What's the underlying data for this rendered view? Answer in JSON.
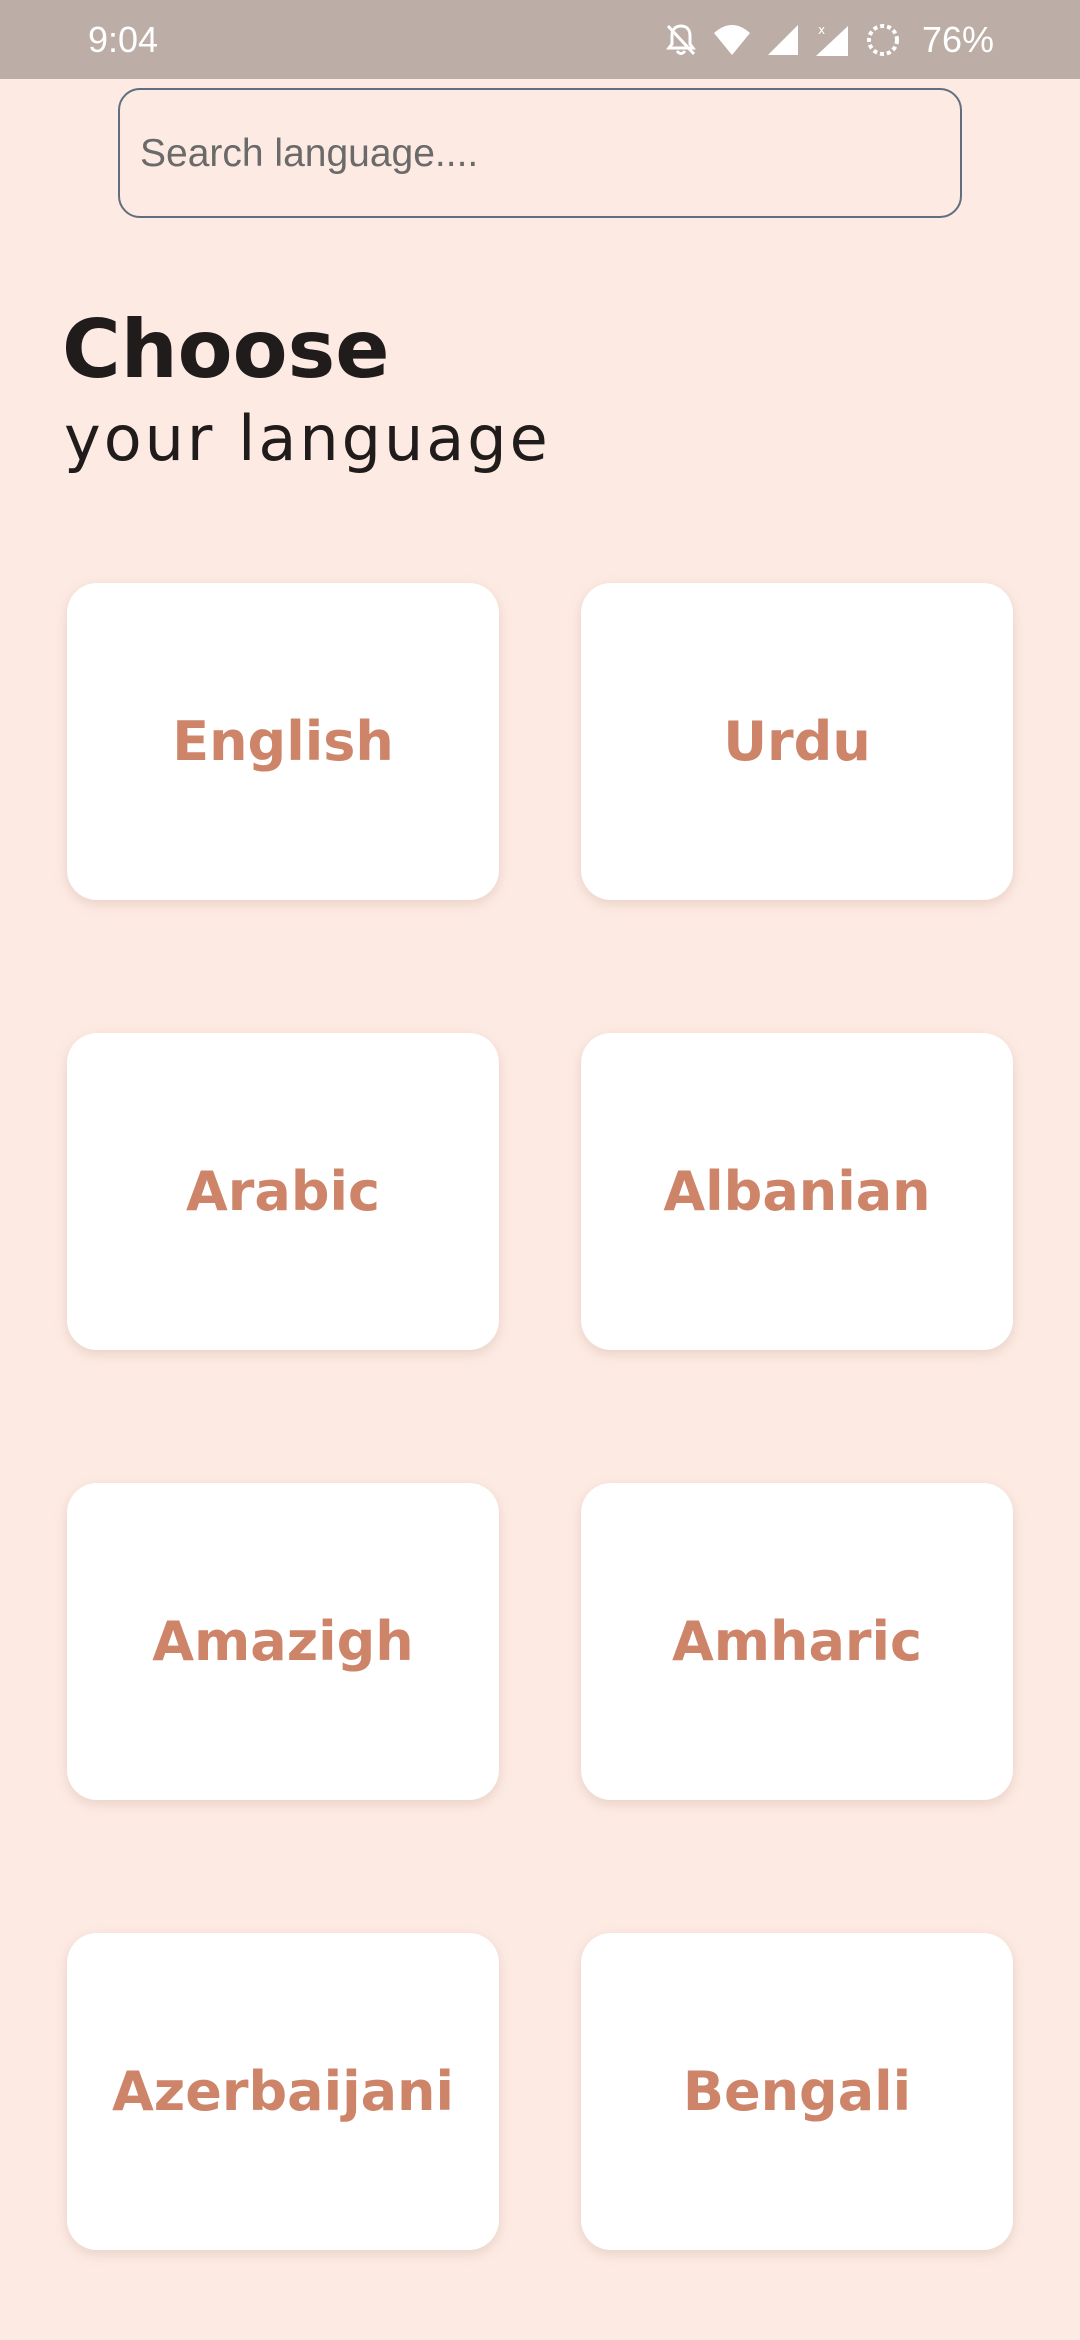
{
  "status_bar": {
    "time": "9:04",
    "battery": "76%",
    "icons": [
      "notifications-off-icon",
      "wifi-icon",
      "signal-icon",
      "signal-x-icon",
      "battery-saver-icon"
    ]
  },
  "search": {
    "placeholder": "Search language....",
    "value": ""
  },
  "heading": {
    "title": "Choose",
    "subtitle": "your language"
  },
  "languages": [
    {
      "label": "English"
    },
    {
      "label": "Urdu"
    },
    {
      "label": "Arabic"
    },
    {
      "label": "Albanian"
    },
    {
      "label": "Amazigh"
    },
    {
      "label": "Amharic"
    },
    {
      "label": "Azerbaijani"
    },
    {
      "label": "Bengali"
    }
  ],
  "colors": {
    "background": "#fdebe3",
    "status_bar": "#bcaea6",
    "card": "#ffffff",
    "accent": "#cd8468",
    "heading": "#201c1b"
  }
}
